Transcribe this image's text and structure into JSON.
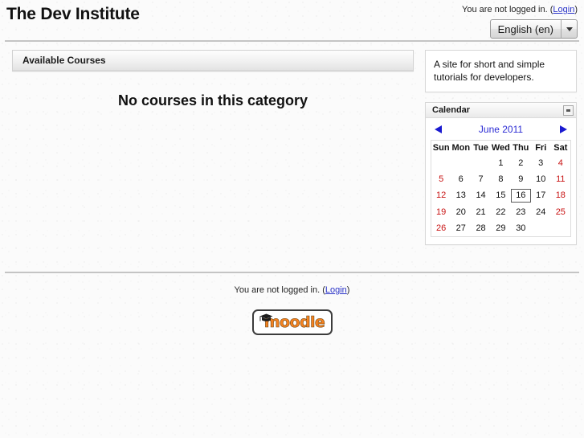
{
  "header": {
    "site_title": "The Dev Institute",
    "login_status_text": "You are not logged in. (",
    "login_link_label": "Login",
    "login_status_suffix": ")",
    "language_selector": {
      "selected": "English (en)",
      "icon": "chevron-down-icon"
    }
  },
  "main": {
    "course_block": {
      "title": "Available Courses",
      "empty_message": "No courses in this category"
    }
  },
  "sidebar": {
    "site_description": {
      "text": "A site for short and simple tutorials for developers."
    },
    "calendar": {
      "title": "Calendar",
      "minimize_icon": "minimize-icon",
      "prev_icon": "arrow-left-icon",
      "next_icon": "arrow-right-icon",
      "month_label": "June 2011",
      "weekday_headers": [
        "Sun",
        "Mon",
        "Tue",
        "Wed",
        "Thu",
        "Fri",
        "Sat"
      ],
      "weeks": [
        [
          "",
          "",
          "",
          "1",
          "2",
          "3",
          "4"
        ],
        [
          "5",
          "6",
          "7",
          "8",
          "9",
          "10",
          "11"
        ],
        [
          "12",
          "13",
          "14",
          "15",
          "16",
          "17",
          "18"
        ],
        [
          "19",
          "20",
          "21",
          "22",
          "23",
          "24",
          "25"
        ],
        [
          "26",
          "27",
          "28",
          "29",
          "30",
          "",
          ""
        ]
      ],
      "today": "16",
      "weekend_columns": [
        0,
        6
      ],
      "colors": {
        "weekend": "#c81212",
        "link": "#2b2bd4"
      }
    }
  },
  "footer": {
    "login_status_text": "You are not logged in. (",
    "login_link_label": "Login",
    "login_status_suffix": ")",
    "logo": {
      "name": "moodle-logo",
      "word": "moodle",
      "color": "#f58220"
    }
  }
}
